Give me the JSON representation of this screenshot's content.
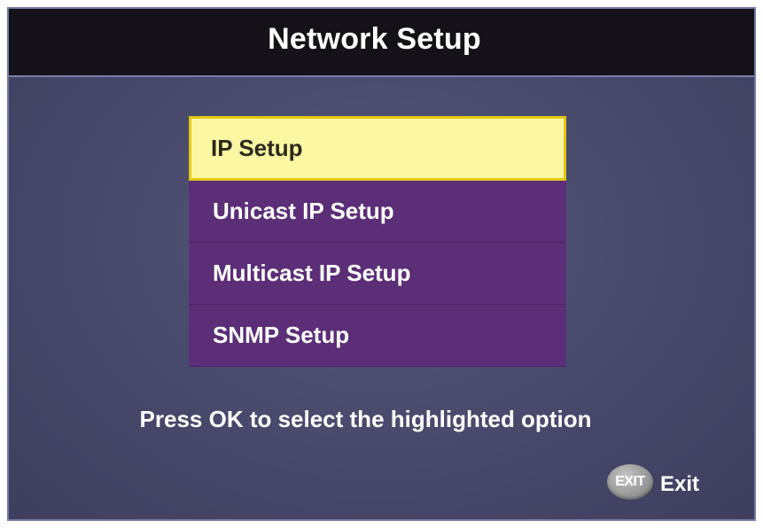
{
  "header": {
    "title": "Network Setup"
  },
  "menu": {
    "items": [
      {
        "label": "IP Setup",
        "selected": true
      },
      {
        "label": "Unicast IP Setup",
        "selected": false
      },
      {
        "label": "Multicast IP Setup",
        "selected": false
      },
      {
        "label": "SNMP Setup",
        "selected": false
      }
    ]
  },
  "footer": {
    "hint": "Press OK to select the highlighted option",
    "exit_icon_text": "EXIT",
    "exit_label": "Exit"
  },
  "colors": {
    "background": "#4a4b6d",
    "title_bar": "#141218",
    "menu_item": "#5b2e77",
    "selected_item": "#fbf7a2",
    "selected_border": "#e2c812"
  },
  "icons": {
    "exit": "exit-button-icon"
  }
}
